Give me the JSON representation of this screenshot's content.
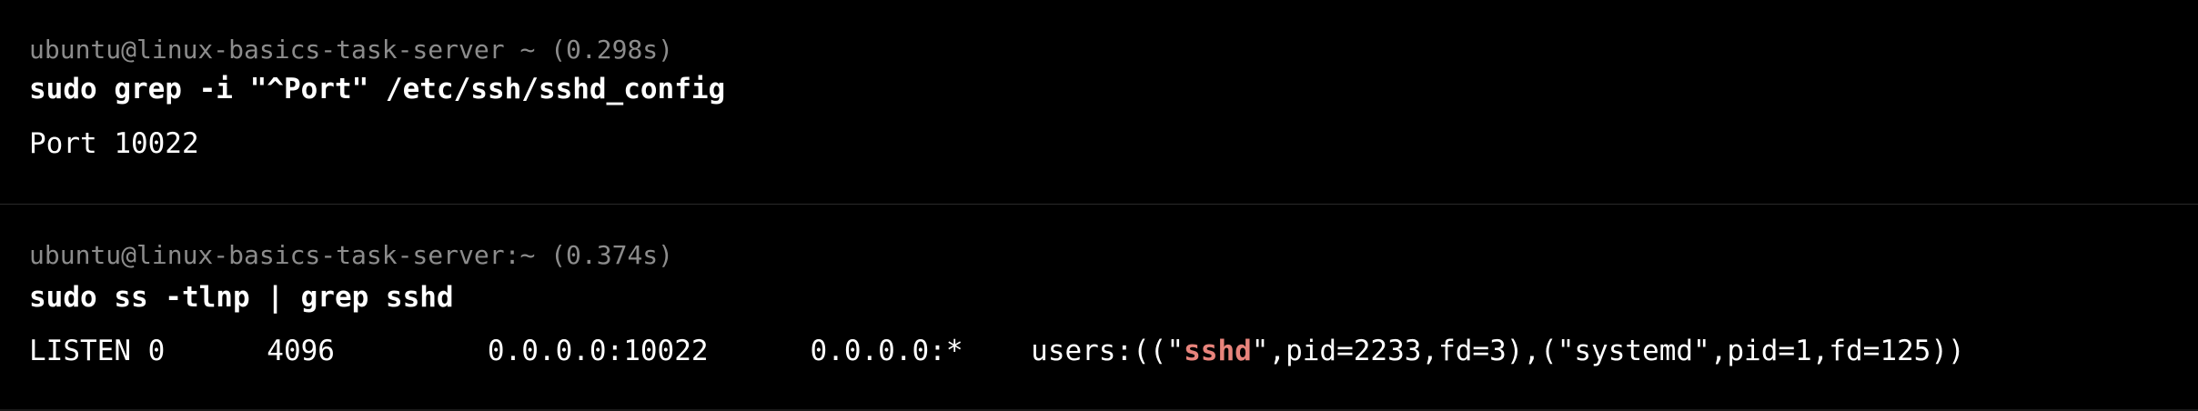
{
  "blocks": [
    {
      "prompt": "ubuntu@linux-basics-task-server ~ (0.298s)",
      "command": "sudo grep -i \"^Port\" /etc/ssh/sshd_config",
      "output": "Port 10022"
    },
    {
      "prompt": "ubuntu@linux-basics-task-server:~ (0.374s)",
      "command": "sudo ss -tlnp | grep sshd",
      "output": {
        "before": "LISTEN 0      4096         0.0.0.0:10022      0.0.0.0:*    users:((\"",
        "highlight": "sshd",
        "after": "\",pid=2233,fd=3),(\"systemd\",pid=1,fd=125))"
      }
    }
  ],
  "colors": {
    "background": "#000000",
    "prompt": "#8c8c8c",
    "text": "#ffffff",
    "highlight": "#e8847c"
  }
}
